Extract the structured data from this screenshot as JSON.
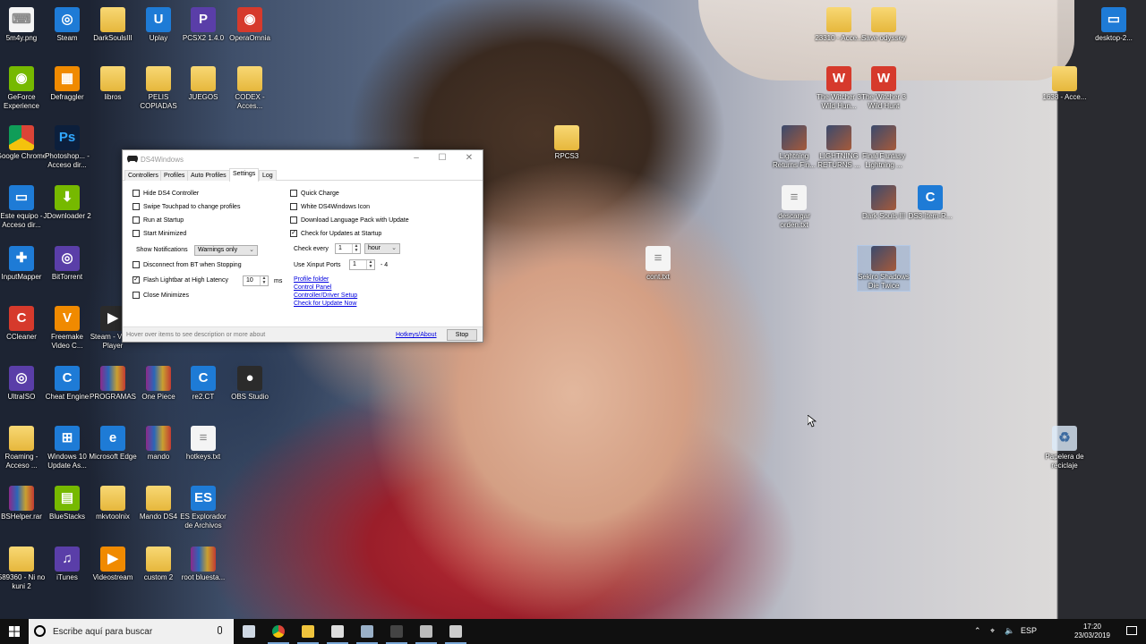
{
  "desktop": {
    "icons": [
      {
        "label": "5m4y.png",
        "glyph": "keyboard-icon"
      },
      {
        "label": "Steam",
        "glyph": "steam-icon"
      },
      {
        "label": "DarkSoulsIII",
        "glyph": "file-icon"
      },
      {
        "label": "Uplay",
        "glyph": "uplay-icon"
      },
      {
        "label": "PCSX2 1.4.0",
        "glyph": "pcsx2-icon"
      },
      {
        "label": "OperaOmnia",
        "glyph": "operaomnia-icon"
      },
      {
        "label": "23310 - Acce...",
        "glyph": "folder-icon"
      },
      {
        "label": "Save odyssey",
        "glyph": "folder-icon"
      },
      {
        "label": "desktop-2...",
        "glyph": "computer-icon"
      },
      {
        "label": "GeForce Experience",
        "glyph": "nvidia-icon"
      },
      {
        "label": "Defraggler",
        "glyph": "defraggler-icon"
      },
      {
        "label": "libros",
        "glyph": "file-icon"
      },
      {
        "label": "PELIS COPIADAS",
        "glyph": "folder-icon"
      },
      {
        "label": "JUEGOS",
        "glyph": "folder-icon"
      },
      {
        "label": "CODEX - Acces...",
        "glyph": "folder-icon"
      },
      {
        "label": "The Witcher 3 Wild Hun...",
        "glyph": "witcher-icon"
      },
      {
        "label": "The Witcher 3 Wild Hunt",
        "glyph": "witcher-icon"
      },
      {
        "label": "1638 - Acce...",
        "glyph": "folder-icon"
      },
      {
        "label": "Google Chrome",
        "glyph": "chrome-icon"
      },
      {
        "label": "Photoshop... - Acceso dir...",
        "glyph": "photoshop-icon"
      },
      {
        "label": "RPCS3",
        "glyph": "folder-icon"
      },
      {
        "label": "Lightning Returns Fin...",
        "glyph": "game-icon"
      },
      {
        "label": "LIGHTNING RETURNS ...",
        "glyph": "game-icon"
      },
      {
        "label": "Final Fantasy Lightning ...",
        "glyph": "game-icon"
      },
      {
        "label": "Este equipo - Acceso dir...",
        "glyph": "computer-icon"
      },
      {
        "label": "JDownloader 2",
        "glyph": "jdownloader-icon"
      },
      {
        "label": "descargar orden.txt",
        "glyph": "txt-icon"
      },
      {
        "label": "Dark Souls III",
        "glyph": "game-icon"
      },
      {
        "label": "DS3-Item-R...",
        "glyph": "cheat-engine-icon"
      },
      {
        "label": "InputMapper",
        "glyph": "inputmapper-icon"
      },
      {
        "label": "BitTorrent",
        "glyph": "bittorrent-icon"
      },
      {
        "label": "cont.txt",
        "glyph": "txt-icon"
      },
      {
        "label": "Sekiro Shadows Die Twice",
        "glyph": "game-icon"
      },
      {
        "label": "CCleaner",
        "glyph": "ccleaner-icon"
      },
      {
        "label": "Freemake Video C...",
        "glyph": "freemake-icon"
      },
      {
        "label": "Steam - Video Player",
        "glyph": "video-icon"
      },
      {
        "label": "UltraISO",
        "glyph": "ultraiso-icon"
      },
      {
        "label": "Cheat Engine",
        "glyph": "cheat-engine-icon"
      },
      {
        "label": "PROGRAMAS",
        "glyph": "rar-icon"
      },
      {
        "label": "One Piece",
        "glyph": "rar-icon"
      },
      {
        "label": "re2.CT",
        "glyph": "cheat-engine-icon"
      },
      {
        "label": "OBS Studio",
        "glyph": "obs-icon"
      },
      {
        "label": "Roaming - Acceso ...",
        "glyph": "folder-icon"
      },
      {
        "label": "Windows 10 Update As...",
        "glyph": "windows-icon"
      },
      {
        "label": "Microsoft Edge",
        "glyph": "edge-icon"
      },
      {
        "label": "mando",
        "glyph": "rar-icon"
      },
      {
        "label": "hotkeys.txt",
        "glyph": "txt-icon"
      },
      {
        "label": "Papelera de reciclaje",
        "glyph": "recycle-bin-icon"
      },
      {
        "label": "BSHelper.rar",
        "glyph": "rar-icon"
      },
      {
        "label": "BlueStacks",
        "glyph": "bluestacks-icon"
      },
      {
        "label": "mkvtoolnix",
        "glyph": "file-icon"
      },
      {
        "label": "Mando DS4",
        "glyph": "file-icon"
      },
      {
        "label": "ES Explorador de Archivos",
        "glyph": "es-explorer-icon"
      },
      {
        "label": "589360 - Ni no kuni 2",
        "glyph": "file-icon"
      },
      {
        "label": "iTunes",
        "glyph": "itunes-icon"
      },
      {
        "label": "Videostream",
        "glyph": "videostream-icon"
      },
      {
        "label": "custom 2",
        "glyph": "folder-icon"
      },
      {
        "label": "root bluesta...",
        "glyph": "rar-icon"
      }
    ]
  },
  "window": {
    "title": "DS4Windows",
    "tabs": [
      "Controllers",
      "Profiles",
      "Auto Profiles",
      "Settings",
      "Log"
    ],
    "active_tab": "Settings",
    "left_options": [
      {
        "label": "Hide DS4 Controller",
        "checked": false
      },
      {
        "label": "Swipe Touchpad to change profiles",
        "checked": false
      },
      {
        "label": "Run at Startup",
        "checked": false
      },
      {
        "label": "Start Minimized",
        "checked": false
      }
    ],
    "notifications": {
      "label": "Show Notifications",
      "value": "Warnings only"
    },
    "left_options_2": [
      {
        "label": "Disconnect from BT when Stopping",
        "checked": false
      },
      {
        "label": "Flash Lightbar at High Latency",
        "checked": true
      },
      {
        "label": "Close Minimizes",
        "checked": false
      }
    ],
    "latency": {
      "value": "10",
      "unit": "ms"
    },
    "right_options": [
      {
        "label": "Quick Charge",
        "checked": false
      },
      {
        "label": "White DS4Windows Icon",
        "checked": false
      },
      {
        "label": "Download Language Pack with Update",
        "checked": false
      },
      {
        "label": "Check for Updates at Startup",
        "checked": true
      }
    ],
    "check_every": {
      "label": "Check every",
      "value": "1",
      "unit": "hour"
    },
    "xinput": {
      "label": "Use Xinput Ports",
      "value": "1",
      "suffix": "- 4"
    },
    "links": [
      "Profile folder",
      "Control Panel",
      "Controller/Driver Setup",
      "Check for Update Now"
    ],
    "status": "Hover over items to see description or more about",
    "hotkeys_link": "Hotkeys/About",
    "stop_button": "Stop"
  },
  "taskbar": {
    "search_placeholder": "Escribe aquí para buscar",
    "apps": [
      "task-view-icon",
      "chrome-icon",
      "file-explorer-icon",
      "ds4windows-icon",
      "steam-icon",
      "app-icon",
      "snipping-icon",
      "ds4-icon"
    ],
    "language": "ESP",
    "time": "17:20",
    "date": "23/03/2019"
  },
  "colors": {
    "taskbar": "#101010",
    "link": "#0000e0",
    "accent": "#7aa7d6"
  }
}
